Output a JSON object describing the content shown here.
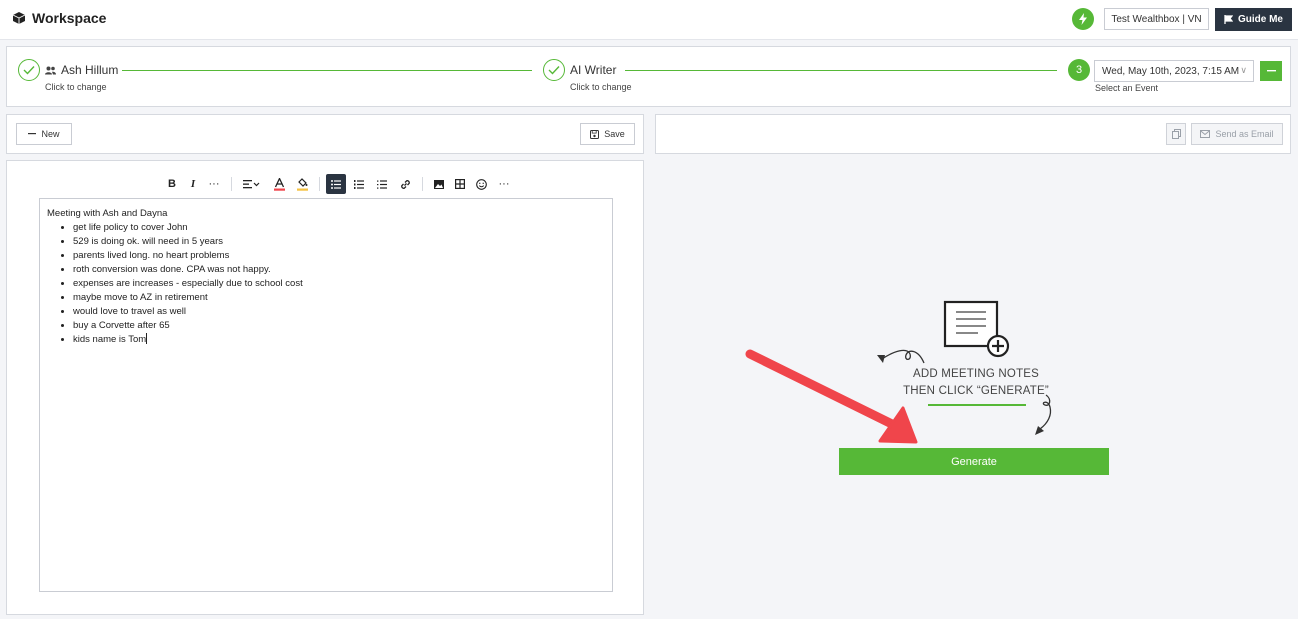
{
  "topbar": {
    "title": "Workspace",
    "account_label": "Test Wealthbox | VN",
    "guide_label": "Guide Me"
  },
  "stepper": {
    "steps": [
      {
        "title": "Ash Hillum",
        "subtitle": "Click to change",
        "state": "done"
      },
      {
        "title": "AI Writer",
        "subtitle": "Click to change",
        "state": "done"
      },
      {
        "number": "3",
        "subtitle": "Select an Event",
        "state": "active"
      }
    ],
    "event_value": "Wed, May 10th, 2023, 7:15 AM"
  },
  "editor_toolbar": {
    "new_label": "New",
    "save_label": "Save"
  },
  "output_toolbar": {
    "send_label": "Send as Email"
  },
  "editor": {
    "heading": "Meeting with Ash and Dayna",
    "items": [
      "get life policy to cover John",
      "529 is doing ok. will need in 5 years",
      "parents lived long. no heart problems",
      "roth conversion was done. CPA was not happy.",
      "expenses are increases - especially due to school cost",
      "maybe move to AZ in retirement",
      "would love to travel as well",
      "buy a Corvette after 65",
      "kids name is Tom"
    ]
  },
  "placeholder": {
    "line1": "ADD MEETING NOTES",
    "line2": "THEN CLICK “GENERATE”"
  },
  "generate_label": "Generate",
  "colors": {
    "accent": "#56b837",
    "dark": "#2a3441",
    "arrow": "#f0454b"
  }
}
